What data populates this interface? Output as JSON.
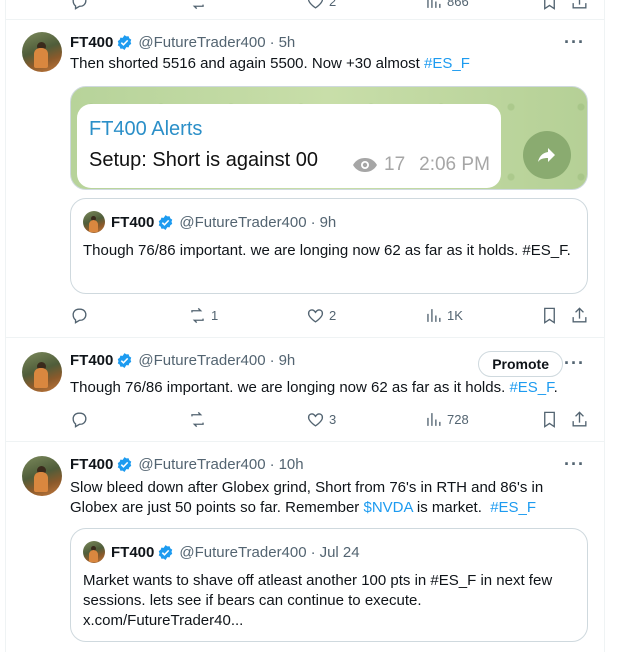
{
  "top_partial": {
    "reply_count": "",
    "like_count": "2",
    "views": "866"
  },
  "tweets": [
    {
      "name": "FT400",
      "handle": "@FutureTrader400",
      "time": "5h",
      "text_main": "Then shorted 5516 and again 5500. Now +30 almost ",
      "hashtag": "#ES_F",
      "media": {
        "title": "FT400 Alerts",
        "text": "Setup: Short is against 00",
        "views": "17",
        "time": "2:06 PM"
      },
      "quote": {
        "name": "FT400",
        "handle": "@FutureTrader400",
        "time": "9h",
        "text": "Though 76/86 important. we are longing now 62 as far as it holds. #ES_F."
      },
      "actions": {
        "replies": "",
        "retweets": "1",
        "likes": "2",
        "views": "1K"
      }
    },
    {
      "name": "FT400",
      "handle": "@FutureTrader400",
      "time": "9h",
      "text_main": "Though 76/86 important. we are longing now 62 as far as it holds. ",
      "hashtag": "#ES_F",
      "text_end": ".",
      "promote_label": "Promote",
      "actions": {
        "replies": "",
        "retweets": "",
        "likes": "3",
        "views": "728"
      }
    },
    {
      "name": "FT400",
      "handle": "@FutureTrader400",
      "time": "10h",
      "text_line1": "Slow bleed down after Globex grind, Short from 76's in RTH and 86's in",
      "text_line2_a": "Globex are just 50 points so far. Remember ",
      "cashtag": "$NVDA",
      "text_line2_b": " is market.  ",
      "hashtag": "#ES_F",
      "quote": {
        "name": "FT400",
        "handle": "@FutureTrader400",
        "time": "Jul 24",
        "text": "Market wants to shave off atleast another 100 pts in #ES_F in next few sessions. lets see if bears can continue to execute. x.com/FutureTrader40..."
      }
    }
  ],
  "colors": {
    "link": "#1d9bf0",
    "muted": "#536471",
    "verified": "#1d9bf0"
  },
  "icons": [
    "reply-icon",
    "retweet-icon",
    "like-icon",
    "views-icon",
    "bookmark-icon",
    "share-icon",
    "verified-badge-icon",
    "more-icon",
    "eye-icon"
  ]
}
